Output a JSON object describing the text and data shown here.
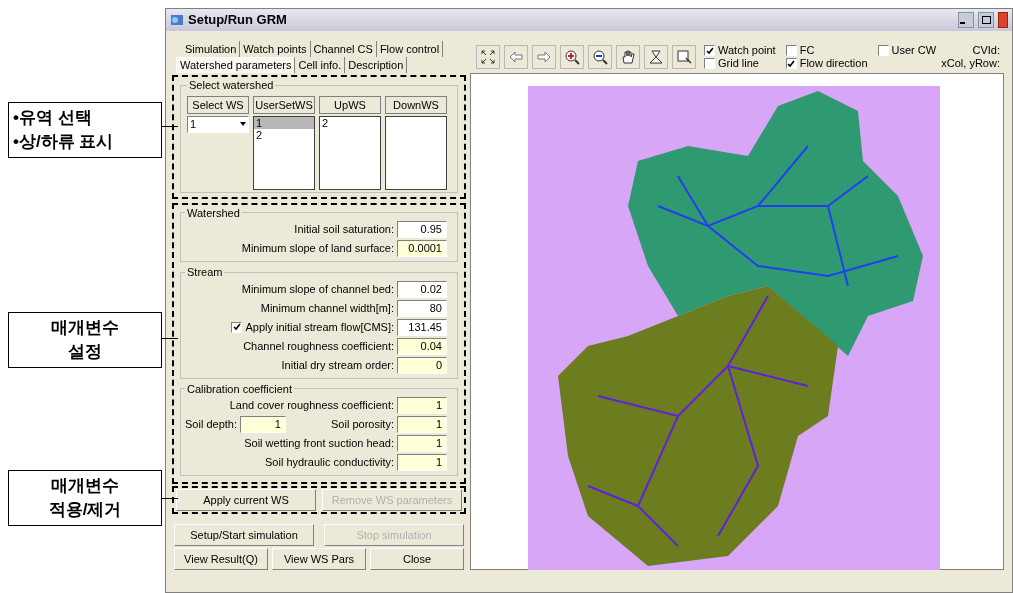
{
  "annotations": [
    {
      "lines": [
        "•유역 선택",
        "•상/하류 표시"
      ]
    },
    {
      "lines": [
        "매개변수",
        "설정"
      ]
    },
    {
      "lines": [
        "매개변수",
        "적용/제거"
      ]
    }
  ],
  "window": {
    "title": "Setup/Run GRM"
  },
  "tabs": [
    [
      {
        "label": "Simulation",
        "selected": false
      },
      {
        "label": "Watch points",
        "selected": false
      },
      {
        "label": "Channel CS",
        "selected": false
      },
      {
        "label": "Flow control",
        "selected": false
      }
    ],
    [
      {
        "label": "Watershed parameters",
        "selected": true
      },
      {
        "label": "Cell info.",
        "selected": false
      },
      {
        "label": "Description",
        "selected": false
      }
    ]
  ],
  "select_watershed": {
    "title": "Select watershed",
    "select_ws": {
      "header": "Select WS",
      "value": "1"
    },
    "lists": [
      {
        "header": "UserSetWS",
        "items": [
          {
            "label": "1",
            "selected": true
          },
          {
            "label": "2",
            "selected": false
          }
        ]
      },
      {
        "header": "UpWS",
        "items": [
          {
            "label": "2",
            "selected": false
          }
        ]
      },
      {
        "header": "DownWS"
      }
    ]
  },
  "groups": [
    {
      "title": "Watershed",
      "rows": [
        [
          {
            "label": "Initial soil saturation:",
            "value": "0.95",
            "highlighted": false
          }
        ],
        [
          {
            "label": "Minimum slope of land surface:",
            "value": "0.0001",
            "highlighted": true
          }
        ]
      ]
    },
    {
      "title": "Stream",
      "rows": [
        [
          {
            "label": "Minimum slope of channel bed:",
            "value": "0.02",
            "highlighted": false
          }
        ],
        [
          {
            "label": "Minimum channel width[m]:",
            "value": "80",
            "highlighted": false
          }
        ],
        [
          {
            "label": "Apply initial stream flow[CMS]:",
            "value": "131.45",
            "highlighted": false,
            "checked": true
          }
        ],
        [
          {
            "label": "Channel roughness coefficient:",
            "value": "0.04",
            "highlighted": true
          }
        ],
        [
          {
            "label": "Initial dry stream order:",
            "value": "0",
            "highlighted": true
          }
        ]
      ]
    },
    {
      "title": "Calibration coefficient",
      "rows": [
        [
          {
            "label": "Land cover roughness coefficient:",
            "value": "1",
            "highlighted": true
          }
        ],
        [
          {
            "label": "Soil depth:",
            "value": "1",
            "highlighted": true
          },
          {
            "label": "Soil porosity:",
            "value": "1",
            "highlighted": true
          }
        ],
        [
          {
            "label": "Soil wetting front suction head:",
            "value": "1",
            "highlighted": true
          }
        ],
        [
          {
            "label": "Soil hydraulic conductivity:",
            "value": "1",
            "highlighted": true
          }
        ]
      ]
    }
  ],
  "ws_buttons": [
    {
      "label": "Apply current WS",
      "disabled": false
    },
    {
      "label": "Remove WS parameters",
      "disabled": true
    }
  ],
  "sim_buttons": [
    {
      "label": "Setup/Start simulation",
      "disabled": false
    },
    {
      "label": "Stop simulation",
      "disabled": true
    }
  ],
  "bottom_buttons": [
    {
      "label": "View Result(Q)",
      "disabled": false
    },
    {
      "label": "View WS Pars",
      "disabled": false
    },
    {
      "label": "Close",
      "disabled": false
    }
  ],
  "map_options": [
    {
      "label": "Watch point",
      "checked": true
    },
    {
      "label": "FC",
      "checked": false
    },
    {
      "label": "User CW",
      "checked": false
    },
    {
      "label": "Grid line",
      "checked": false
    },
    {
      "label": "Flow direction",
      "checked": true
    }
  ],
  "map_info": [
    "CVId:",
    "xCol, yRow:"
  ]
}
